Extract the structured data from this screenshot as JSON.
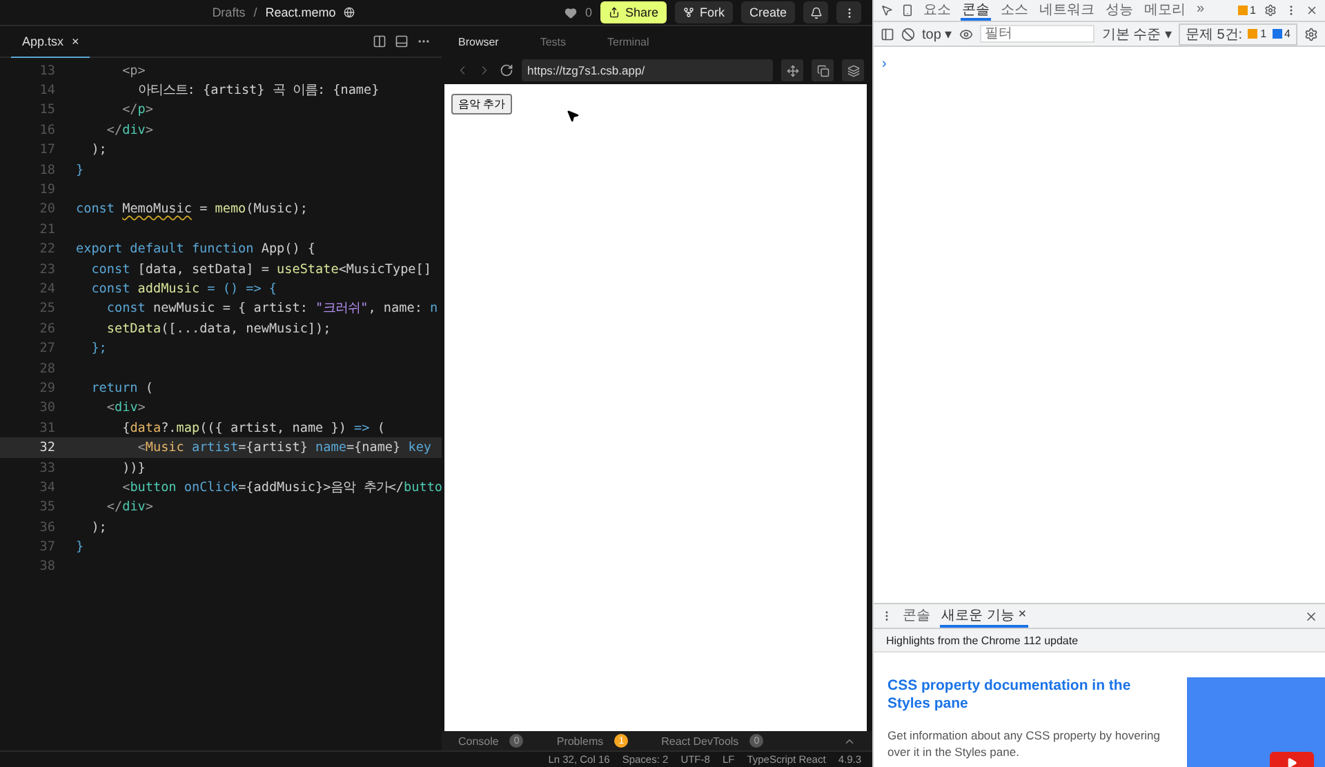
{
  "topbar": {
    "breadcrumb": [
      "Drafts",
      "React.memo"
    ],
    "separator": "/",
    "likes": "0",
    "buttons": [
      {
        "label": "Share",
        "kind": "primary"
      },
      {
        "label": "Fork",
        "kind": "fork"
      },
      {
        "label": "Create",
        "kind": "plain"
      }
    ]
  },
  "editor": {
    "tab": "App.tsx",
    "close": "×",
    "lines": [
      {
        "n": "13",
        "current": false,
        "tokens": [
          {
            "text": "      <p>",
            "kind": "punct"
          }
        ]
      },
      {
        "n": "14",
        "current": false,
        "tokens": [
          {
            "text": "        아티스트: {artist} 곡 이름: {name}",
            "kind": "plain"
          }
        ]
      },
      {
        "n": "15",
        "current": false,
        "tokens": [
          {
            "text": "      </",
            "kind": "punct"
          },
          {
            "text": "p",
            "kind": "tag"
          },
          {
            "text": ">",
            "kind": "punct"
          }
        ]
      },
      {
        "n": "16",
        "current": false,
        "tokens": [
          {
            "text": "    </",
            "kind": "punct"
          },
          {
            "text": "div",
            "kind": "tag"
          },
          {
            "text": ">",
            "kind": "punct"
          }
        ]
      },
      {
        "n": "17",
        "current": false,
        "tokens": [
          {
            "text": "  );",
            "kind": "plain"
          }
        ]
      },
      {
        "n": "18",
        "current": false,
        "tokens": [
          {
            "text": "}",
            "kind": "kw"
          }
        ]
      },
      {
        "n": "19",
        "current": false
      },
      {
        "n": "20",
        "current": false,
        "tokens": [
          {
            "text": "const ",
            "kind": "kw"
          },
          {
            "text": "MemoMusic",
            "kind": "warn"
          },
          {
            "text": " = ",
            "kind": "plain"
          },
          {
            "text": "memo",
            "kind": "fn"
          },
          {
            "text": "(Music);",
            "kind": "plain"
          }
        ]
      },
      {
        "n": "21",
        "current": false
      },
      {
        "n": "22",
        "current": false,
        "tokens": [
          {
            "text": "export default function ",
            "kind": "kw"
          },
          {
            "text": "App() {",
            "kind": "plain"
          }
        ]
      },
      {
        "n": "23",
        "current": false,
        "tokens": [
          {
            "text": "  const ",
            "kind": "kw"
          },
          {
            "text": "[data, setData] = ",
            "kind": "plain"
          },
          {
            "text": "useState",
            "kind": "fn"
          },
          {
            "text": "<MusicType[]",
            "kind": "plain"
          }
        ]
      },
      {
        "n": "24",
        "current": false,
        "tokens": [
          {
            "text": "  const ",
            "kind": "kw"
          },
          {
            "text": "addMusic",
            "kind": "fn"
          },
          {
            "text": " = () => {",
            "kind": "kw"
          }
        ]
      },
      {
        "n": "25",
        "current": false,
        "tokens": [
          {
            "text": "    const ",
            "kind": "kw"
          },
          {
            "text": "newMusic = { artist: ",
            "kind": "plain"
          },
          {
            "text": "\"크러쉬\"",
            "kind": "str"
          },
          {
            "text": ", name: ",
            "kind": "plain"
          },
          {
            "text": "n",
            "kind": "kw"
          }
        ]
      },
      {
        "n": "26",
        "current": false,
        "tokens": [
          {
            "text": "    setData",
            "kind": "fn"
          },
          {
            "text": "([...data, newMusic]);",
            "kind": "plain"
          }
        ]
      },
      {
        "n": "27",
        "current": false,
        "tokens": [
          {
            "text": "  };",
            "kind": "kw"
          }
        ]
      },
      {
        "n": "28",
        "current": false
      },
      {
        "n": "29",
        "current": false,
        "tokens": [
          {
            "text": "  return ",
            "kind": "kw"
          },
          {
            "text": "(",
            "kind": "plain"
          }
        ]
      },
      {
        "n": "30",
        "current": false,
        "tokens": [
          {
            "text": "    <",
            "kind": "punct"
          },
          {
            "text": "div",
            "kind": "tag"
          },
          {
            "text": ">",
            "kind": "punct"
          }
        ]
      },
      {
        "n": "31",
        "current": false,
        "tokens": [
          {
            "text": "      {",
            "kind": "plain"
          },
          {
            "text": "data",
            "kind": "comp"
          },
          {
            "text": "?.",
            "kind": "plain"
          },
          {
            "text": "map",
            "kind": "fn"
          },
          {
            "text": "(({ artist, name }) ",
            "kind": "plain"
          },
          {
            "text": "=>",
            "kind": "kw"
          },
          {
            "text": " (",
            "kind": "plain"
          }
        ]
      },
      {
        "n": "32",
        "current": true,
        "tokens": [
          {
            "text": "        <",
            "kind": "punct"
          },
          {
            "text": "Music",
            "kind": "comp"
          },
          {
            "text": " artist",
            "kind": "kw"
          },
          {
            "text": "={artist} ",
            "kind": "plain"
          },
          {
            "text": "name",
            "kind": "kw"
          },
          {
            "text": "={name} ",
            "kind": "plain"
          },
          {
            "text": "key",
            "kind": "kw"
          }
        ]
      },
      {
        "n": "33",
        "current": false,
        "tokens": [
          {
            "text": "      ))}",
            "kind": "plain"
          }
        ]
      },
      {
        "n": "34",
        "current": false,
        "tokens": [
          {
            "text": "      <",
            "kind": "punct"
          },
          {
            "text": "button",
            "kind": "tag"
          },
          {
            "text": " onClick",
            "kind": "kw"
          },
          {
            "text": "={addMusic}>음악 추가</",
            "kind": "plain"
          },
          {
            "text": "butto",
            "kind": "tag"
          }
        ]
      },
      {
        "n": "35",
        "current": false,
        "tokens": [
          {
            "text": "    </",
            "kind": "punct"
          },
          {
            "text": "div",
            "kind": "tag"
          },
          {
            "text": ">",
            "kind": "punct"
          }
        ]
      },
      {
        "n": "36",
        "current": false,
        "tokens": [
          {
            "text": "  );",
            "kind": "plain"
          }
        ]
      },
      {
        "n": "37",
        "current": false,
        "tokens": [
          {
            "text": "}",
            "kind": "kw"
          }
        ]
      },
      {
        "n": "38",
        "current": false
      }
    ]
  },
  "preview": {
    "tabs": [
      {
        "label": "Browser",
        "selected": true
      },
      {
        "label": "Tests",
        "selected": false
      },
      {
        "label": "Terminal",
        "selected": false
      }
    ],
    "url": "https://tzg7s1.csb.app/",
    "page_button": "음악 추가",
    "panel_tabs": [
      {
        "label": "Console",
        "count": "0",
        "kind": "neutral"
      },
      {
        "label": "Problems",
        "count": "1",
        "kind": "warning"
      },
      {
        "label": "React DevTools",
        "count": "0",
        "kind": "neutral"
      }
    ]
  },
  "status_bar": [
    "Ln 32, Col 16",
    "Spaces: 2",
    "UTF-8",
    "LF",
    "TypeScript React",
    "4.9.3"
  ],
  "devtools": {
    "tabs": [
      {
        "label": "요소",
        "selected": false
      },
      {
        "label": "콘솔",
        "selected": true
      },
      {
        "label": "소스",
        "selected": false
      },
      {
        "label": "네트워크",
        "selected": false
      },
      {
        "label": "성능",
        "selected": false
      },
      {
        "label": "메모리",
        "selected": false
      }
    ],
    "more": "»",
    "issues_badge": "1",
    "context": "top ▾",
    "filter": {
      "placeholder": "필터"
    },
    "level": "기본 수준 ▾",
    "issues_label": "문제 5건:",
    "warnings": "1",
    "infos": "4",
    "prompt": "›",
    "drawer": {
      "tabs": [
        {
          "label": "콘솔",
          "selected": false
        },
        {
          "label": "새로운 기능",
          "selected": true
        }
      ],
      "tab_close": "×",
      "highlights": "Highlights from the Chrome 112 update",
      "article_title": "CSS property documentation in the Styles pane",
      "article_body": "Get information about any CSS property by hovering over it in the Styles pane."
    }
  }
}
